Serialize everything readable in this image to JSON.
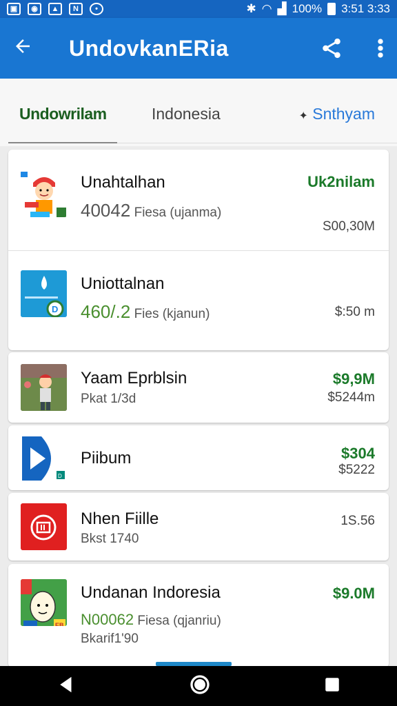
{
  "status_bar": {
    "notification_icons": [
      "image-icon",
      "bag-icon",
      "bag-icon",
      "n-icon",
      "chat-icon"
    ],
    "battery_text": "100%",
    "time": "3:51 3:33"
  },
  "app_bar": {
    "title": "UndovkanERia",
    "color": "#1976d2"
  },
  "tabs": [
    {
      "label": "Undowrilam",
      "active": true
    },
    {
      "label": "Indonesia",
      "active": false
    },
    {
      "label": "Snthyam",
      "prefix": "✦",
      "active": false
    }
  ],
  "items": [
    {
      "name": "Unahtalhan",
      "count": "40042",
      "sub": "Fiesa (ujanma)",
      "right_top": "Uk2nilam",
      "right_bottom": "S00,30M"
    },
    {
      "name": "Uniottalnan",
      "count": "460/.2",
      "sub": "Fies (kjanun)",
      "right_bottom": "$:50 m"
    },
    {
      "name": "Yaam Eprblsin",
      "sub": "Pkat 1/3d",
      "right_top": "$9,9M",
      "right_bottom": "$5244m"
    },
    {
      "name": "Piibum",
      "right_top": "$304",
      "right_bottom": "$5222"
    },
    {
      "name": "Nhen Fiille",
      "sub": "Bkst 1740",
      "right_bottom": "1S.56"
    },
    {
      "name": "Undanan Indoresia",
      "count": "N00062",
      "sub": "Fiesa (qjanriu)",
      "sub2": "Bkarif1'90",
      "right_top": "$9.0M"
    }
  ],
  "thumb_badges": {
    "item2": "D",
    "item4": "D",
    "item6": "EB"
  },
  "nav": [
    "back-icon",
    "home-icon",
    "recents-icon"
  ]
}
